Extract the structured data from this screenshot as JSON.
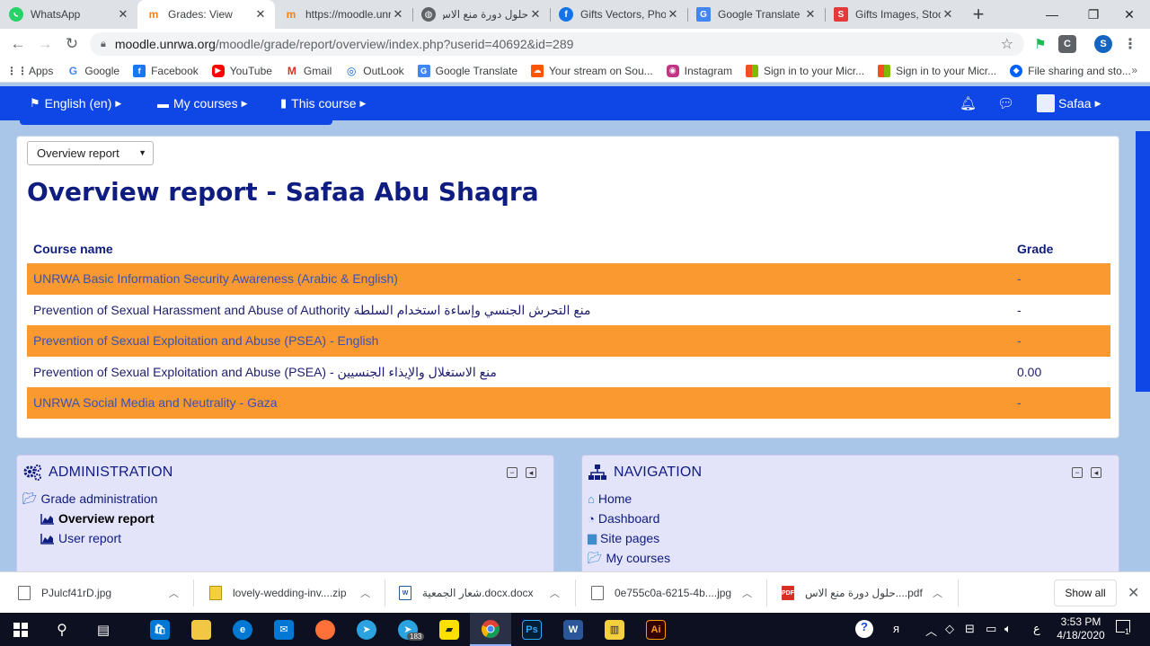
{
  "browser": {
    "tabs": [
      {
        "title": "WhatsApp",
        "icon": "whatsapp-icon",
        "color": "#25d366",
        "active": false
      },
      {
        "title": "Grades: View",
        "icon": "moodle-icon",
        "color": "#f98012",
        "active": true
      },
      {
        "title": "https://moodle.unrwa",
        "icon": "moodle-icon",
        "color": "#f98012",
        "active": false
      },
      {
        "title": "حلول دورة منع الاس",
        "icon": "globe-icon",
        "color": "#5f6368",
        "active": false
      },
      {
        "title": "Gifts Vectors, Photo",
        "icon": "freepik-icon",
        "color": "#1273eb",
        "active": false
      },
      {
        "title": "Google Translate",
        "icon": "google-translate-icon",
        "color": "#4285f4",
        "active": false
      },
      {
        "title": "Gifts Images, Stock",
        "icon": "shutterstock-icon",
        "color": "#e43a3a",
        "active": false
      }
    ],
    "url_host": "moodle.unrwa.org",
    "url_path": "/moodle/grade/report/overview/index.php?userid=40692&id=289",
    "profile_initial": "S",
    "bookmarks": [
      {
        "label": "Apps",
        "icon": "apps-grid-icon",
        "color": "#5f6368"
      },
      {
        "label": "Google",
        "icon": "google-icon",
        "color": "#4285f4"
      },
      {
        "label": "Facebook",
        "icon": "facebook-icon",
        "color": "#1877f2"
      },
      {
        "label": "YouTube",
        "icon": "youtube-icon",
        "color": "#ff0000"
      },
      {
        "label": "Gmail",
        "icon": "gmail-icon",
        "color": "#d93025"
      },
      {
        "label": "OutLook",
        "icon": "outlook-icon",
        "color": "#0a64d8"
      },
      {
        "label": "Google Translate",
        "icon": "google-translate-icon",
        "color": "#4285f4"
      },
      {
        "label": "Your stream on Sou...",
        "icon": "soundcloud-icon",
        "color": "#ff5500"
      },
      {
        "label": "Instagram",
        "icon": "instagram-icon",
        "color": "#c13584"
      },
      {
        "label": "Sign in to your Micr...",
        "icon": "microsoft-icon",
        "color": "#f25022"
      },
      {
        "label": "Sign in to your Micr...",
        "icon": "microsoft-icon",
        "color": "#f25022"
      },
      {
        "label": "File sharing and sto...",
        "icon": "file-sharing-icon",
        "color": "#0061fe"
      }
    ],
    "bookmarks_more": "»"
  },
  "moodle_nav": {
    "language": "English (en)",
    "my_courses": "My courses",
    "this_course": "This course",
    "user": "Safaa",
    "bar_color": "#0f47e6"
  },
  "report": {
    "selector_value": "Overview report",
    "title": "Overview report - Safaa Abu Shaqra",
    "col_course": "Course name",
    "col_grade": "Grade",
    "rows": [
      {
        "course": "UNRWA Basic Information Security Awareness (Arabic & English)",
        "grade": "-"
      },
      {
        "course": "Prevention of Sexual Harassment and Abuse of Authority منع التحرش الجنسي وإساءة استخدام السلطة",
        "grade": "-"
      },
      {
        "course": "Prevention of Sexual Exploitation and Abuse (PSEA) - English",
        "grade": "-"
      },
      {
        "course": "Prevention of Sexual Exploitation and Abuse (PSEA) - منع الاستغلال والإيذاء الجنسيين",
        "grade": "0.00"
      },
      {
        "course": "UNRWA Social Media and Neutrality - Gaza",
        "grade": "-"
      }
    ],
    "highlight_color": "#f9992f"
  },
  "administration": {
    "title": "ADMINISTRATION",
    "items": [
      {
        "label": "Grade administration",
        "icon": "folder-open-icon"
      },
      {
        "label": "Overview report",
        "icon": "chart-area-icon"
      },
      {
        "label": "User report",
        "icon": "chart-area-icon"
      }
    ]
  },
  "navigation": {
    "title": "NAVIGATION",
    "items": [
      {
        "label": "Home",
        "icon": "home-icon"
      },
      {
        "label": "Dashboard",
        "icon": "dashboard-icon"
      },
      {
        "label": "Site pages",
        "icon": "folder-icon"
      },
      {
        "label": "My courses",
        "icon": "folder-open-icon"
      }
    ]
  },
  "downloads": {
    "items": [
      {
        "name": "PJulcf41rD.jpg",
        "icon": "image-file-icon"
      },
      {
        "name": "lovely-wedding-inv....zip",
        "icon": "zip-file-icon"
      },
      {
        "name": "شعار الجمعية.docx.docx",
        "icon": "word-file-icon"
      },
      {
        "name": "0e755c0a-6215-4b....jpg",
        "icon": "image-file-icon"
      },
      {
        "name": "حلول دورة منع الاس....pdf",
        "icon": "pdf-file-icon"
      }
    ],
    "show_all": "Show all"
  },
  "taskbar": {
    "time": "3:53 PM",
    "date": "4/18/2020",
    "language_indicator": "ع",
    "notification_badge": "1",
    "telegram_badge": "183"
  }
}
